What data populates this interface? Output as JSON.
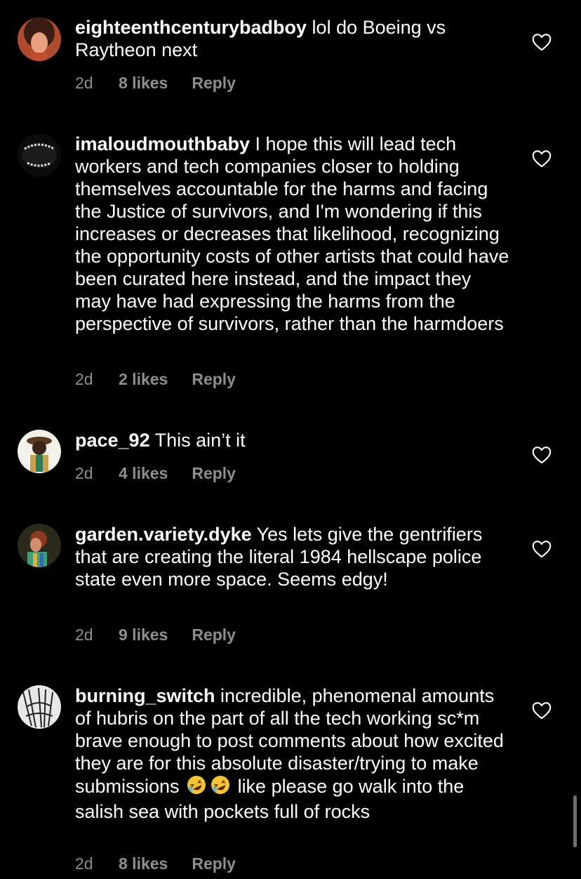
{
  "comments": [
    {
      "username": "eighteenthcenturybadboy",
      "text": " lol do Boeing vs Raytheon next",
      "time": "2d",
      "likes": "8 likes",
      "reply": "Reply"
    },
    {
      "username": "imaloudmouthbaby",
      "text": " I hope this will lead tech workers and tech companies closer to holding themselves accountable for the harms and facing the Justice of survivors, and I'm wondering if this increases or decreases that likelihood, recognizing the opportunity costs of other artists that could have been curated here instead, and the impact they may have had expressing the harms from the perspective of survivors, rather than the harmdoers",
      "time": "2d",
      "likes": "2 likes",
      "reply": "Reply"
    },
    {
      "username": "pace_92",
      "text": " This ain’t it",
      "time": "2d",
      "likes": "4 likes",
      "reply": "Reply"
    },
    {
      "username": "garden.variety.dyke",
      "text": " Yes lets give the gentrifiers that are creating the literal 1984 hellscape police state even more space. Seems edgy!",
      "time": "2d",
      "likes": "9 likes",
      "reply": "Reply"
    },
    {
      "username": "burning_switch",
      "text_before_emoji": " incredible, phenomenal amounts of hubris on the part of all the tech working sc*m brave enough to post comments about how excited they are for this absolute disaster/trying to make submissions ",
      "text_after_emoji": " like please go walk into the salish sea with pockets full of rocks",
      "emoji": "rolling-on-floor-laughing-emoji x2",
      "time": "2d",
      "likes": "8 likes",
      "reply": "Reply"
    }
  ],
  "icons": {
    "like": "heart-outline-icon"
  },
  "colors": {
    "background": "#000000",
    "text": "#ffffff",
    "meta": "#8e8e8e"
  }
}
